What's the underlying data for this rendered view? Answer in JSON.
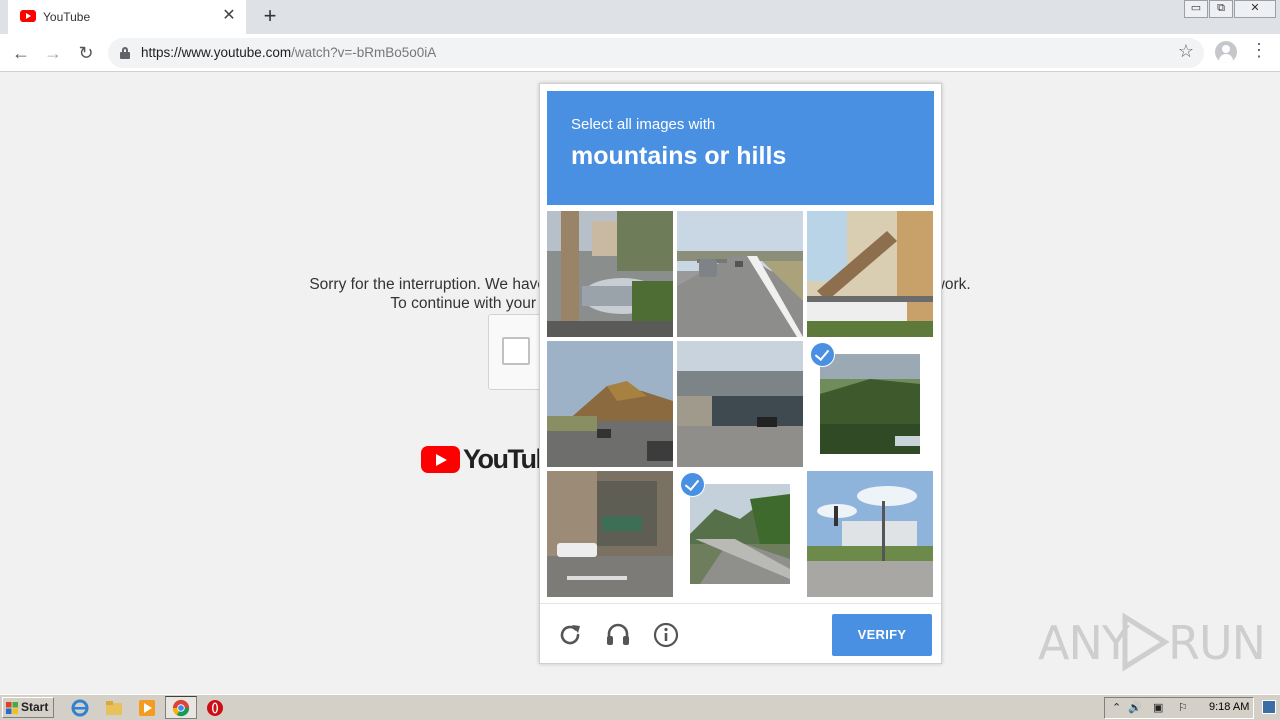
{
  "browser": {
    "tab_title": "YouTube",
    "url_host": "https://www.youtube.com",
    "url_path": "/watch?v=-bRmBo5o0iA",
    "window_controls": {
      "minimize": "▭",
      "restore": "⧉",
      "close": "✕"
    }
  },
  "page": {
    "message_line1": "Sorry for the interruption. We have been receiving a large volume of requests from your network.",
    "message_line2": "To continue with your YouTube experience, please fill out the form below.",
    "logo_text": "YouTube"
  },
  "captcha": {
    "instruction": "Select all images with",
    "keyword": "mountains or hills",
    "tiles": [
      {
        "scene": "street-pole-trees",
        "selected": false
      },
      {
        "scene": "highway-road",
        "selected": false
      },
      {
        "scene": "house-stairs",
        "selected": false
      },
      {
        "scene": "street-hills",
        "selected": false
      },
      {
        "scene": "bridge-underpass",
        "selected": false
      },
      {
        "scene": "forest-hill",
        "selected": true
      },
      {
        "scene": "city-street",
        "selected": false
      },
      {
        "scene": "road-mountains",
        "selected": true
      },
      {
        "scene": "building-traffic-light",
        "selected": false
      }
    ],
    "footer_icons": [
      "reload-icon",
      "headphones-icon",
      "info-icon"
    ],
    "verify_label": "VERIFY"
  },
  "watermark": {
    "text_left": "ANY",
    "text_right": "RUN"
  },
  "taskbar": {
    "start_label": "Start",
    "clock": "9:18 AM"
  },
  "colors": {
    "captcha_blue": "#4a90e2",
    "youtube_red": "#ff0000"
  }
}
